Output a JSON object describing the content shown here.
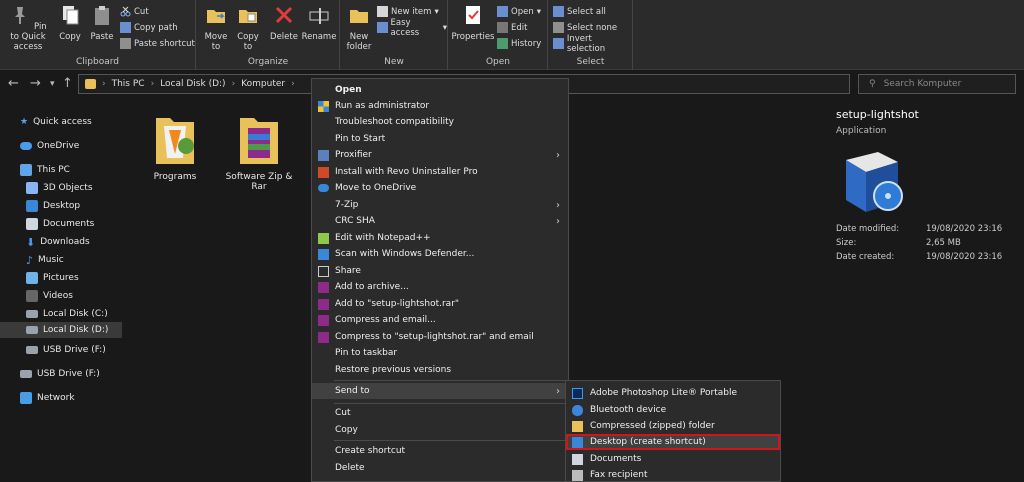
{
  "ribbon": {
    "clipboard": {
      "pin_label": "Pin to Quick access",
      "copy_label": "Copy",
      "paste_label": "Paste",
      "cut_label": "Cut",
      "copy_path_label": "Copy path",
      "paste_shortcut_label": "Paste shortcut",
      "group_label": "Clipboard"
    },
    "organize": {
      "move_to_label": "Move to",
      "copy_to_label": "Copy to",
      "delete_label": "Delete",
      "rename_label": "Rename",
      "group_label": "Organize"
    },
    "new": {
      "new_folder_label": "New folder",
      "new_item_label": "New item",
      "easy_access_label": "Easy access",
      "group_label": "New"
    },
    "open": {
      "properties_label": "Properties",
      "open_label": "Open",
      "edit_label": "Edit",
      "history_label": "History",
      "group_label": "Open"
    },
    "select": {
      "select_all_label": "Select all",
      "select_none_label": "Select none",
      "invert_selection_label": "Invert selection",
      "group_label": "Select"
    }
  },
  "address": {
    "crumbs": [
      "This PC",
      "Local Disk (D:)",
      "Komputer"
    ],
    "search_placeholder": "Search Komputer"
  },
  "navpane": {
    "items": [
      {
        "label": "Quick access"
      },
      {
        "label": "OneDrive"
      },
      {
        "label": "This PC"
      },
      {
        "label": "3D Objects"
      },
      {
        "label": "Desktop"
      },
      {
        "label": "Documents"
      },
      {
        "label": "Downloads"
      },
      {
        "label": "Music"
      },
      {
        "label": "Pictures"
      },
      {
        "label": "Videos"
      },
      {
        "label": "Local Disk (C:)"
      },
      {
        "label": "Local Disk (D:)"
      },
      {
        "label": "USB Drive (F:)"
      },
      {
        "label": "USB Drive (F:)"
      },
      {
        "label": "Network"
      }
    ]
  },
  "content": {
    "folders": [
      {
        "name": "Programs"
      },
      {
        "name": "Software Zip & Rar"
      }
    ]
  },
  "details": {
    "name": "setup-lightshot",
    "type": "Application",
    "rows": [
      {
        "key": "Date modified:",
        "value": "19/08/2020 23:16"
      },
      {
        "key": "Size:",
        "value": "2,65 MB"
      },
      {
        "key": "Date created:",
        "value": "19/08/2020 23:16"
      }
    ]
  },
  "context_menu": {
    "items": [
      {
        "label": "Open"
      },
      {
        "label": "Run as administrator"
      },
      {
        "label": "Troubleshoot compatibility"
      },
      {
        "label": "Pin to Start"
      },
      {
        "label": "Proxifier"
      },
      {
        "label": "Install with Revo Uninstaller Pro"
      },
      {
        "label": "Move to OneDrive"
      },
      {
        "label": "7-Zip"
      },
      {
        "label": "CRC SHA"
      },
      {
        "label": "Edit with Notepad++"
      },
      {
        "label": "Scan with Windows Defender..."
      },
      {
        "label": "Share"
      },
      {
        "label": "Add to archive..."
      },
      {
        "label": "Add to \"setup-lightshot.rar\""
      },
      {
        "label": "Compress and email..."
      },
      {
        "label": "Compress to \"setup-lightshot.rar\" and email"
      },
      {
        "label": "Pin to taskbar"
      },
      {
        "label": "Restore previous versions"
      },
      {
        "label": "Send to"
      },
      {
        "label": "Cut"
      },
      {
        "label": "Copy"
      },
      {
        "label": "Create shortcut"
      },
      {
        "label": "Delete"
      }
    ]
  },
  "send_to": {
    "items": [
      {
        "label": "Adobe Photoshop Lite® Portable"
      },
      {
        "label": "Bluetooth device"
      },
      {
        "label": "Compressed (zipped) folder"
      },
      {
        "label": "Desktop (create shortcut)"
      },
      {
        "label": "Documents"
      },
      {
        "label": "Fax recipient"
      }
    ]
  },
  "colors": {
    "background": "#191919",
    "ribbon": "#2b2b2b",
    "menu_background": "#2b2b2b",
    "highlight_border": "#d0161b",
    "folder_yellow": "#e8c15a"
  }
}
